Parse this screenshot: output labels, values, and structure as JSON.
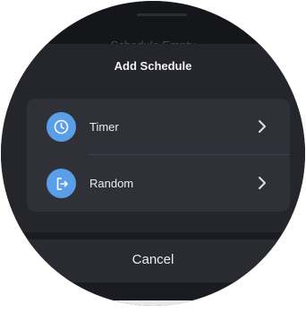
{
  "background_screen": {
    "title_partial": "Schedule Empty"
  },
  "sheet": {
    "title": "Add Schedule",
    "options": [
      {
        "label": "Timer",
        "icon": "clock-icon"
      },
      {
        "label": "Random",
        "icon": "random-exit-icon"
      }
    ],
    "cancel_label": "Cancel"
  },
  "colors": {
    "accent": "#5a9ee8",
    "sheet_bg": "#25262c",
    "card_bg": "#303138",
    "text": "#ececef"
  }
}
